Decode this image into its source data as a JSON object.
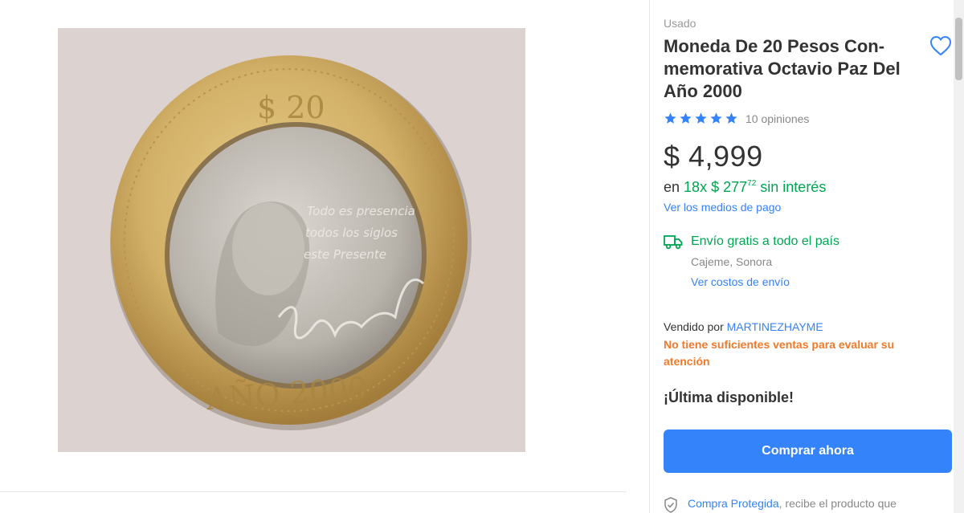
{
  "product": {
    "condition": "Usado",
    "title": "Moneda De 20 Pesos Con-memorativa Octavio Paz Del Año 2000",
    "rating": 5,
    "reviews_text": "10 opiniones",
    "price": "$ 4,999",
    "installments": {
      "prefix": "en",
      "count_text": "18x",
      "amount": "$ 277",
      "cents": "72",
      "suffix": "sin interés"
    },
    "payment_link": "Ver los medios de pago"
  },
  "shipping": {
    "title": "Envío gratis a todo el país",
    "location": "Cajeme, Sonora",
    "costs_link": "Ver costos de envío"
  },
  "seller": {
    "prefix": "Vendido por",
    "name": "MARTINEZHAYME",
    "warning": "No tiene suficientes ventas para evaluar su atención"
  },
  "stock_text": "¡Última disponible!",
  "buy_button_label": "Comprar ahora",
  "protection": {
    "link": "Compra Protegida",
    "text": ", recibe el producto que"
  },
  "image": {
    "coin_top_text": "$ 20",
    "coin_bottom_text": "AÑO 2000",
    "coin_quote_line1": "Todo es presencia",
    "coin_quote_line2": "todos los siglos",
    "coin_quote_line3": "este Presente"
  },
  "colors": {
    "accent": "#3483fa",
    "green": "#00a650",
    "warning": "#f07a2c"
  }
}
